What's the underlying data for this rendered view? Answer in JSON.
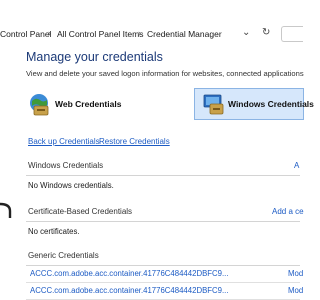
{
  "breadcrumb": {
    "items": [
      "Control Panel",
      "All Control Panel Items",
      "Credential Manager"
    ],
    "separator": "›"
  },
  "page": {
    "title": "Manage your credentials",
    "description": "View and delete your saved logon information for websites, connected applications"
  },
  "tabs": {
    "web": "Web Credentials",
    "windows": "Windows Credentials"
  },
  "links": {
    "backup": "Back up Credentials",
    "restore": "Restore Credentials"
  },
  "sections": {
    "windows": {
      "title": "Windows Credentials",
      "action": "A",
      "empty": "No Windows credentials."
    },
    "certificate": {
      "title": "Certificate-Based Credentials",
      "action": "Add a ce",
      "empty": "No certificates."
    },
    "generic": {
      "title": "Generic Credentials",
      "rows": [
        {
          "name": "ACCC.com.adobe.acc.container.41776C484442DBFC9...",
          "modified": "Mod"
        },
        {
          "name": "ACCC.com.adobe.acc.container.41776C484442DBFC9...",
          "modified": "Mod"
        }
      ]
    }
  },
  "colors": {
    "accent": "#1c5bc4",
    "title": "#1c3a78",
    "selected_tab": "#d6e7fb"
  },
  "icons": [
    "chevron-down-icon",
    "refresh-icon",
    "web-credentials-icon",
    "windows-credentials-icon"
  ]
}
